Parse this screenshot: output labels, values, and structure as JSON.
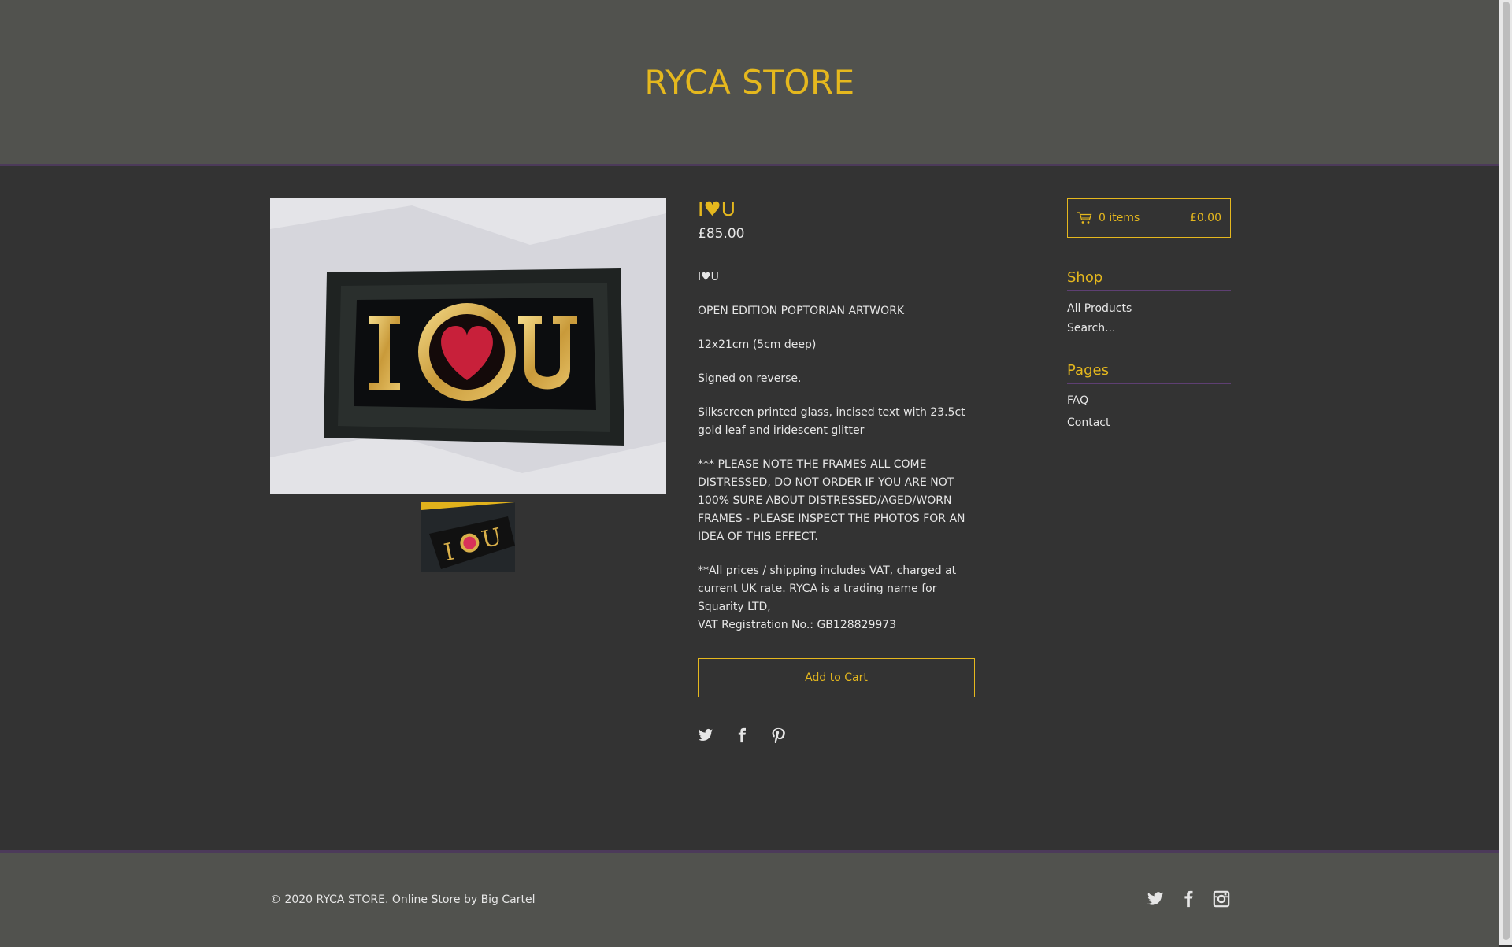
{
  "store": {
    "name": "RYCA STORE"
  },
  "product": {
    "title": "I♥U",
    "price": "£85.00",
    "description": [
      "I♥U",
      "OPEN EDITION POPTORIAN ARTWORK",
      "12x21cm (5cm deep)",
      "Signed on reverse.",
      "Silkscreen printed glass, incised text with 23.5ct gold leaf and iridescent glitter",
      "*** PLEASE NOTE THE FRAMES ALL COME DISTRESSED, DO NOT ORDER IF YOU ARE NOT 100% SURE ABOUT DISTRESSED/AGED/WORN FRAMES - PLEASE INSPECT THE PHOTOS FOR AN IDEA OF THIS EFFECT.",
      "**All prices / shipping includes VAT, charged at current UK rate. RYCA is a trading name for Squarity LTD,",
      "VAT Registration No.: GB128829973"
    ],
    "add_to_cart_label": "Add to Cart",
    "share_icons": [
      "twitter-icon",
      "facebook-icon",
      "pinterest-icon"
    ]
  },
  "cart": {
    "items_label": "0 items",
    "total": "£0.00"
  },
  "sidebar": {
    "shop": {
      "heading": "Shop",
      "links": [
        "All Products"
      ],
      "search_placeholder": "Search..."
    },
    "pages": {
      "heading": "Pages",
      "links": [
        "FAQ",
        "Contact"
      ]
    }
  },
  "footer": {
    "copyright": "© 2020 RYCA STORE. Online Store by Big Cartel",
    "social_icons": [
      "twitter-icon",
      "facebook-icon",
      "instagram-icon"
    ]
  },
  "colors": {
    "accent": "#e5b81e",
    "header_bg": "#51524e",
    "body_bg": "#333333",
    "divider": "#5e3f73"
  }
}
